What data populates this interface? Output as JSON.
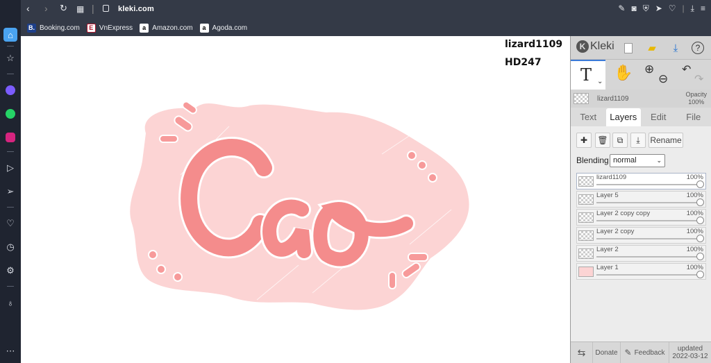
{
  "browser": {
    "url": "kleki.com",
    "bookmarks": [
      {
        "label": "Booking.com",
        "fav": "B.",
        "color": "#1d3f8a"
      },
      {
        "label": "VnExpress",
        "fav": "E",
        "color": "#b0162d"
      },
      {
        "label": "Amazon.com",
        "fav": "a",
        "color": "#ffffff"
      },
      {
        "label": "Agoda.com",
        "fav": "a",
        "color": "#ffffff"
      }
    ]
  },
  "canvas": {
    "artist": "lizard1109",
    "code": "HD247",
    "artwork_text": "Cao"
  },
  "kleki": {
    "logo": "Kleki",
    "current_layer": "lizard1109",
    "opacity_label": "Opacity",
    "opacity_value": "100%",
    "tabs": [
      "Text",
      "Layers",
      "Edit",
      "File"
    ],
    "active_tab": "Layers",
    "rename_label": "Rename",
    "blending_label": "Blending",
    "blending_value": "normal",
    "layers": [
      {
        "name": "lizard1109",
        "opacity": "100%"
      },
      {
        "name": "Layer 5",
        "opacity": "100%"
      },
      {
        "name": "Layer 2 copy copy",
        "opacity": "100%"
      },
      {
        "name": "Layer 2 copy",
        "opacity": "100%"
      },
      {
        "name": "Layer 2",
        "opacity": "100%"
      },
      {
        "name": "Layer 1",
        "opacity": "100%"
      }
    ],
    "footer": {
      "donate": "Donate",
      "feedback": "Feedback",
      "updated": "updated",
      "updated_date": "2022-03-12"
    }
  },
  "colors": {
    "accent": "#3b7bd9",
    "art_pink": "#f48c8c",
    "art_bg": "#fcd4d4"
  }
}
